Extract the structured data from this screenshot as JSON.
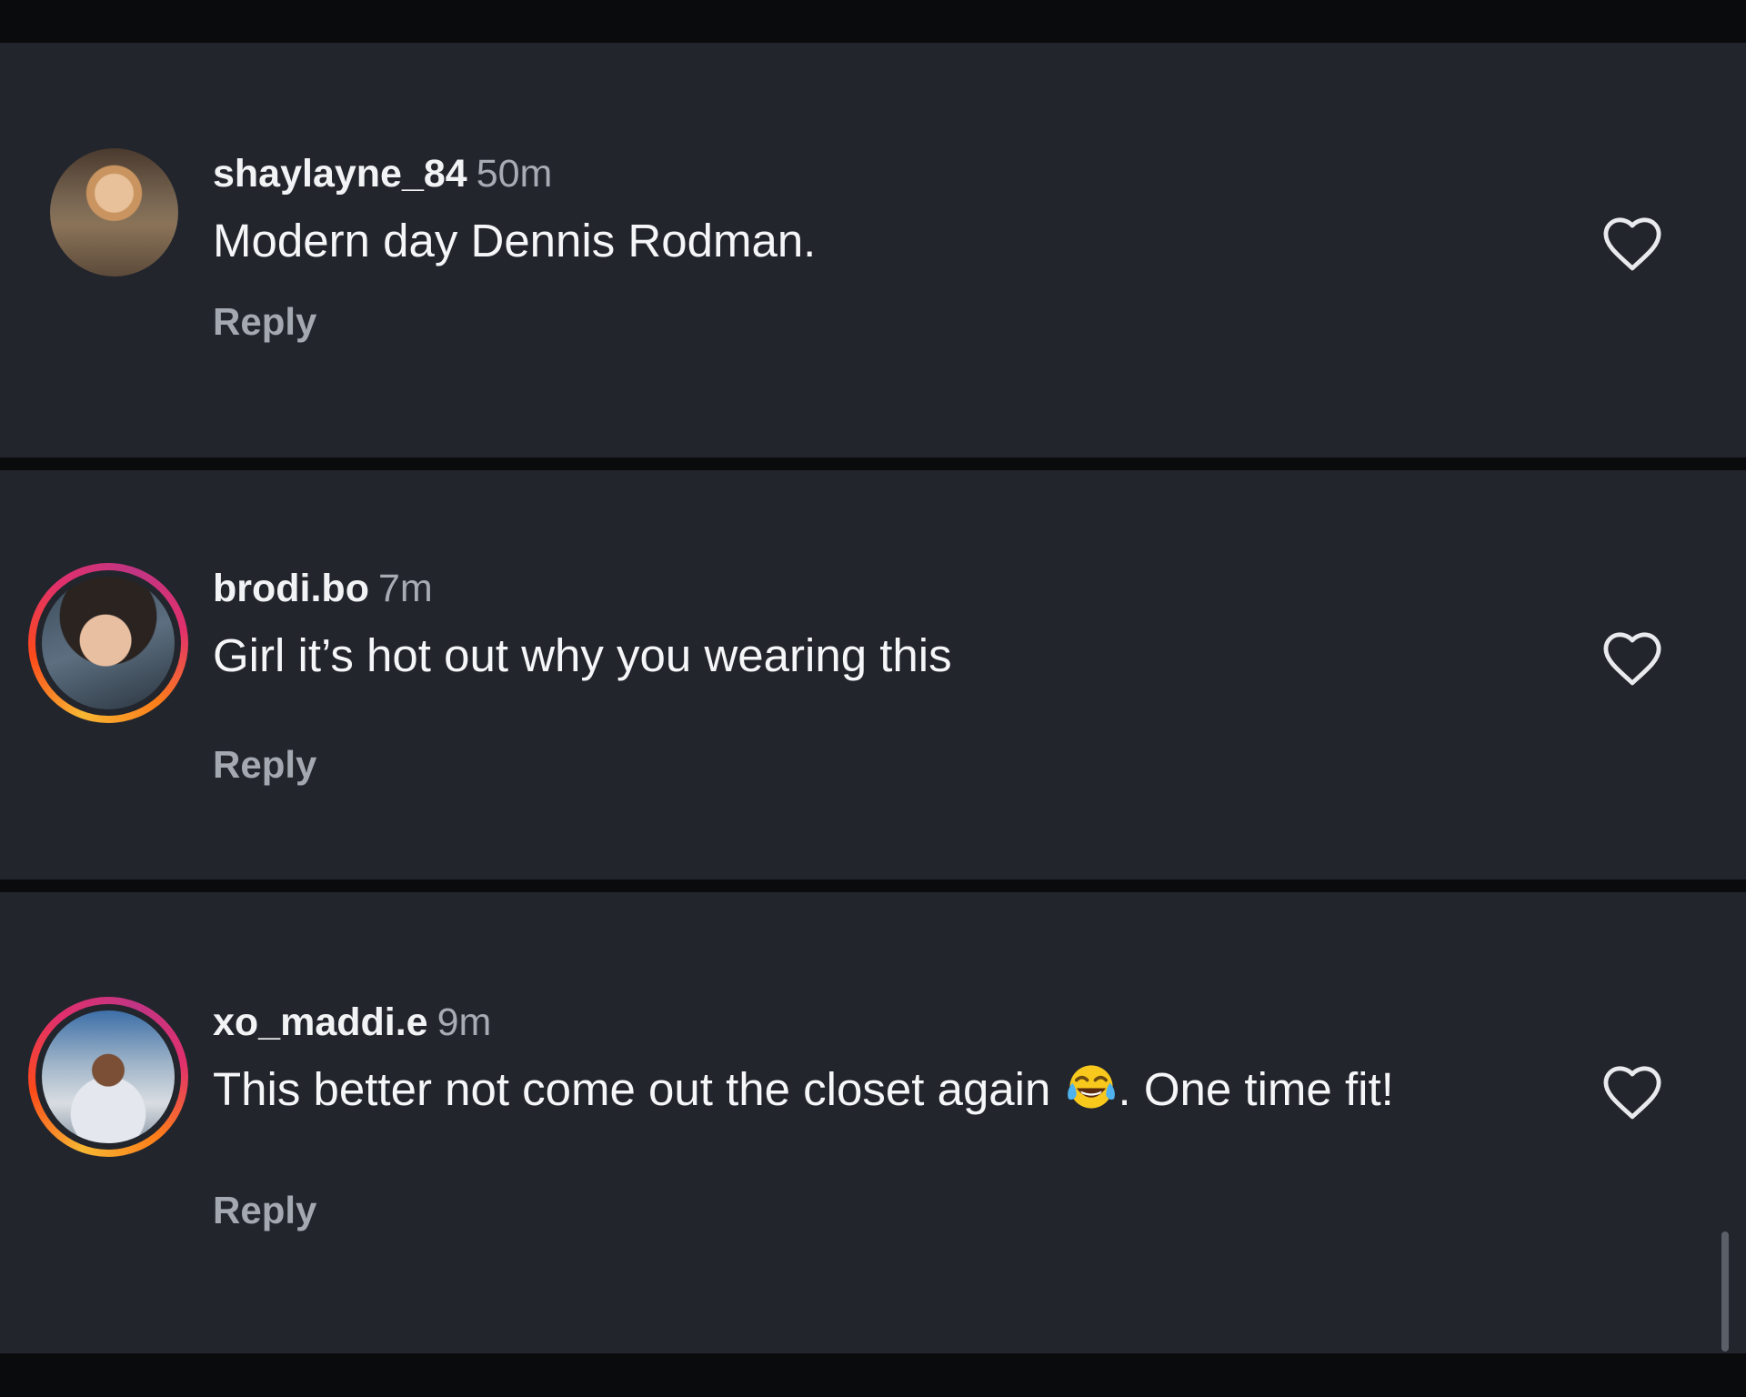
{
  "comments": [
    {
      "username": "shaylayne_84",
      "time": "50m",
      "text": "Modern day Dennis Rodman.",
      "reply_label": "Reply",
      "avatar_icon": "profile-photo",
      "story_ring": false,
      "liked": false
    },
    {
      "username": "brodi.bo",
      "time": "7m",
      "text": "Girl it’s hot out why you wearing this",
      "reply_label": "Reply",
      "avatar_icon": "profile-photo",
      "story_ring": true,
      "liked": false
    },
    {
      "username": "xo_maddi.e",
      "time": "9m",
      "text_before_emoji": "This better not come out the closet again ",
      "emoji": "face-with-tears-of-joy",
      "text_after_emoji": ". One time fit!",
      "reply_label": "Reply",
      "avatar_icon": "profile-photo",
      "story_ring": true,
      "liked": false
    }
  ],
  "colors": {
    "background": "#0a0b0d",
    "panel": "#22252c",
    "username": "#f2f3f5",
    "time": "#a7abb3",
    "comment_text": "#f5f6f8",
    "reply": "#a4a8b0",
    "heart_outline": "#e9eaee"
  },
  "icons": {
    "like": "heart-outline-icon"
  }
}
